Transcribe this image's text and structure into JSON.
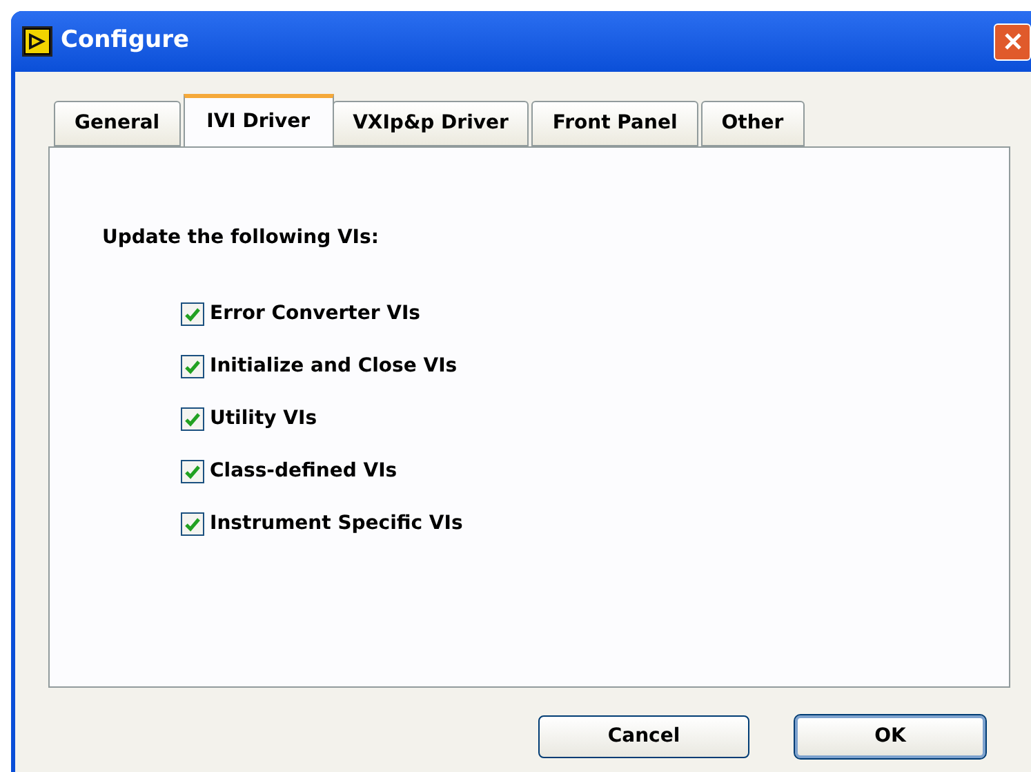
{
  "window": {
    "title": "Configure"
  },
  "tabs": [
    {
      "label": "General",
      "selected": false
    },
    {
      "label": "IVI Driver",
      "selected": true
    },
    {
      "label": "VXIp&p Driver",
      "selected": false
    },
    {
      "label": "Front Panel",
      "selected": false
    },
    {
      "label": "Other",
      "selected": false
    }
  ],
  "prompt": "Update the following VIs:",
  "options": [
    {
      "label": "Error Converter VIs",
      "checked": true
    },
    {
      "label": "Initialize and Close VIs",
      "checked": true
    },
    {
      "label": "Utility VIs",
      "checked": true
    },
    {
      "label": "Class-defined VIs",
      "checked": true
    },
    {
      "label": "Instrument Specific VIs",
      "checked": true
    }
  ],
  "buttons": [
    {
      "label": "Cancel",
      "default": false
    },
    {
      "label": "OK",
      "default": true
    }
  ]
}
